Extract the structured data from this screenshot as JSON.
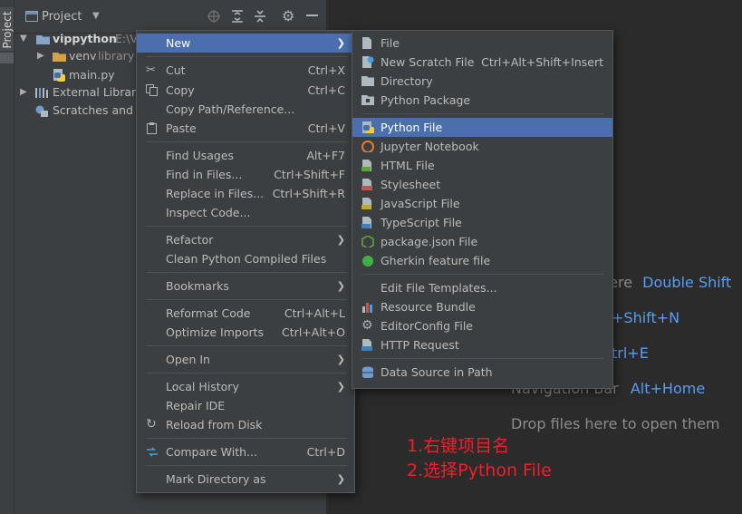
{
  "tool_strip": {
    "label": "Project"
  },
  "project_panel": {
    "title": "Project",
    "tree": [
      {
        "label": "vippython",
        "suffix": "E:\\V"
      },
      {
        "label": "venv",
        "suffix": "library"
      },
      {
        "label": "main.py"
      },
      {
        "label": "External Librarie"
      },
      {
        "label": "Scratches and C"
      }
    ]
  },
  "context_menu": {
    "items": [
      {
        "label": "New",
        "shortcut": ""
      },
      {
        "label": "Cut",
        "shortcut": "Ctrl+X"
      },
      {
        "label": "Copy",
        "shortcut": "Ctrl+C"
      },
      {
        "label": "Copy Path/Reference...",
        "shortcut": ""
      },
      {
        "label": "Paste",
        "shortcut": "Ctrl+V"
      },
      {
        "label": "Find Usages",
        "shortcut": "Alt+F7"
      },
      {
        "label": "Find in Files...",
        "shortcut": "Ctrl+Shift+F"
      },
      {
        "label": "Replace in Files...",
        "shortcut": "Ctrl+Shift+R"
      },
      {
        "label": "Inspect Code...",
        "shortcut": ""
      },
      {
        "label": "Refactor",
        "shortcut": ""
      },
      {
        "label": "Clean Python Compiled Files",
        "shortcut": ""
      },
      {
        "label": "Bookmarks",
        "shortcut": ""
      },
      {
        "label": "Reformat Code",
        "shortcut": "Ctrl+Alt+L"
      },
      {
        "label": "Optimize Imports",
        "shortcut": "Ctrl+Alt+O"
      },
      {
        "label": "Open In",
        "shortcut": ""
      },
      {
        "label": "Local History",
        "shortcut": ""
      },
      {
        "label": "Repair IDE",
        "shortcut": ""
      },
      {
        "label": "Reload from Disk",
        "shortcut": ""
      },
      {
        "label": "Compare With...",
        "shortcut": "Ctrl+D"
      },
      {
        "label": "Mark Directory as",
        "shortcut": ""
      }
    ]
  },
  "new_submenu": {
    "items": [
      {
        "label": "File",
        "shortcut": ""
      },
      {
        "label": "New Scratch File",
        "shortcut": "Ctrl+Alt+Shift+Insert"
      },
      {
        "label": "Directory",
        "shortcut": ""
      },
      {
        "label": "Python Package",
        "shortcut": ""
      },
      {
        "label": "Python File",
        "shortcut": ""
      },
      {
        "label": "Jupyter Notebook",
        "shortcut": ""
      },
      {
        "label": "HTML File",
        "shortcut": ""
      },
      {
        "label": "Stylesheet",
        "shortcut": ""
      },
      {
        "label": "JavaScript File",
        "shortcut": ""
      },
      {
        "label": "TypeScript File",
        "shortcut": ""
      },
      {
        "label": "package.json File",
        "shortcut": ""
      },
      {
        "label": "Gherkin feature file",
        "shortcut": ""
      },
      {
        "label": "Edit File Templates...",
        "shortcut": ""
      },
      {
        "label": "Resource Bundle",
        "shortcut": ""
      },
      {
        "label": "EditorConfig File",
        "shortcut": ""
      },
      {
        "label": "HTTP Request",
        "shortcut": ""
      },
      {
        "label": "Data Source in Path",
        "shortcut": ""
      }
    ]
  },
  "editor_hints": [
    {
      "text": "here",
      "key": "Double Shift"
    },
    {
      "text": "",
      "key": "+Shift+N"
    },
    {
      "text": "",
      "key": "trl+E"
    },
    {
      "text": "Navigation Bar",
      "key": "Alt+Home"
    },
    {
      "text": "Drop files here to open them",
      "key": ""
    }
  ],
  "annotations": [
    "1.右键项目名",
    "2.选择Python File"
  ],
  "colors": {
    "selection": "#4b6eaf",
    "accent_key": "#589df6",
    "annotation": "#f0202a"
  }
}
